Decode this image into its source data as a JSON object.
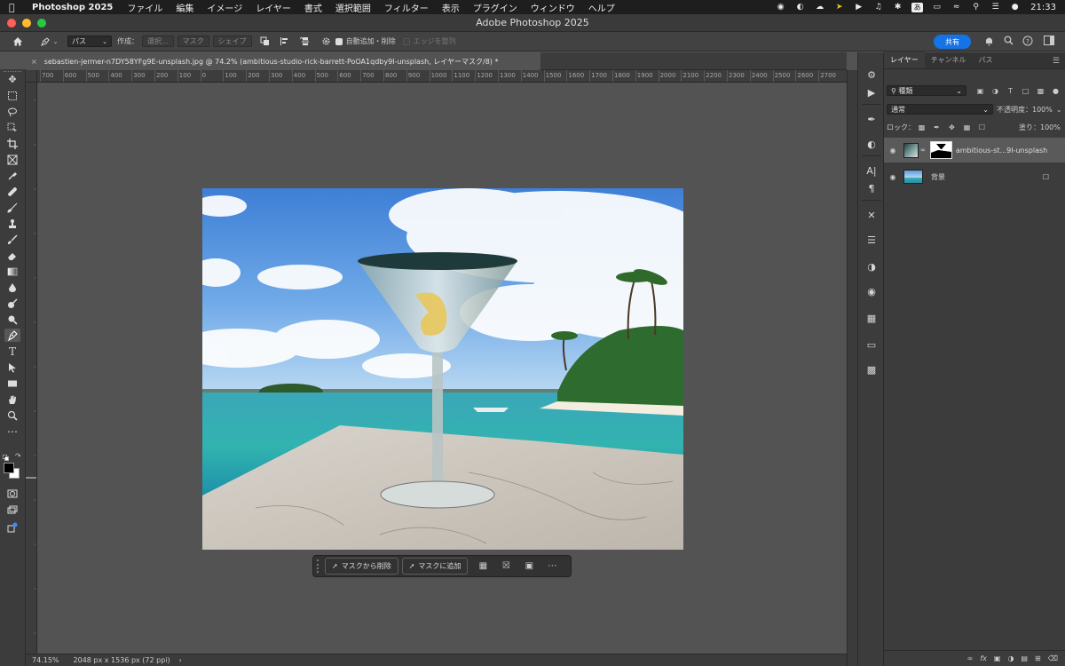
{
  "menubar": {
    "app_name": "Photoshop 2025",
    "items": [
      "ファイル",
      "編集",
      "イメージ",
      "レイヤー",
      "書式",
      "選択範囲",
      "フィルター",
      "表示",
      "プラグイン",
      "ウィンドウ",
      "ヘルプ"
    ],
    "ime": "あ",
    "clock": "21:33"
  },
  "window": {
    "title": "Adobe Photoshop 2025"
  },
  "options": {
    "mode_value": "パス",
    "create_label": "作成：",
    "select_button": "選択...",
    "mask_button": "マスク",
    "shape_button": "シェイプ",
    "auto_add_label": "自動追加・削除",
    "align_edges_label": "エッジを整列",
    "share_label": "共有"
  },
  "document": {
    "tab_title": "sebastien-jermer-n7DY58YFg9E-unsplash.jpg @ 74.2% (ambitious-studio-rick-barrett-PoOA1qdby9I-unsplash, レイヤーマスク/8) *"
  },
  "ruler": {
    "top_labels": [
      "700",
      "600",
      "500",
      "400",
      "300",
      "200",
      "100",
      "0",
      "100",
      "200",
      "300",
      "400",
      "500",
      "600",
      "700",
      "800",
      "900",
      "1000",
      "1100",
      "1200",
      "1300",
      "1400",
      "1500",
      "1600",
      "1700",
      "1800",
      "1900",
      "2000",
      "2100",
      "2200",
      "2300",
      "2400",
      "2500",
      "2600",
      "2700"
    ]
  },
  "taskbar": {
    "remove_from_mask": "マスクから削除",
    "add_to_mask": "マスクに追加"
  },
  "statusbar": {
    "zoom": "74.15%",
    "dimensions": "2048 px x 1536 px (72 ppi)"
  },
  "layers": {
    "tabs": [
      "レイヤー",
      "チャンネル",
      "パス"
    ],
    "filter_kind": "種類",
    "blend_mode": "通常",
    "opacity_label": "不透明度：",
    "opacity_value": "100%",
    "lock_label": "ロック：",
    "fill_label": "塗り：",
    "fill_value": "100%",
    "items": [
      {
        "name": "ambitious-st...9I-unsplash",
        "selected": true
      },
      {
        "name": "背景",
        "selected": false
      }
    ]
  },
  "colors": {
    "accent": "#1473e6",
    "close": "#ff5f57",
    "minimize": "#febc2e",
    "zoom": "#28c840"
  }
}
